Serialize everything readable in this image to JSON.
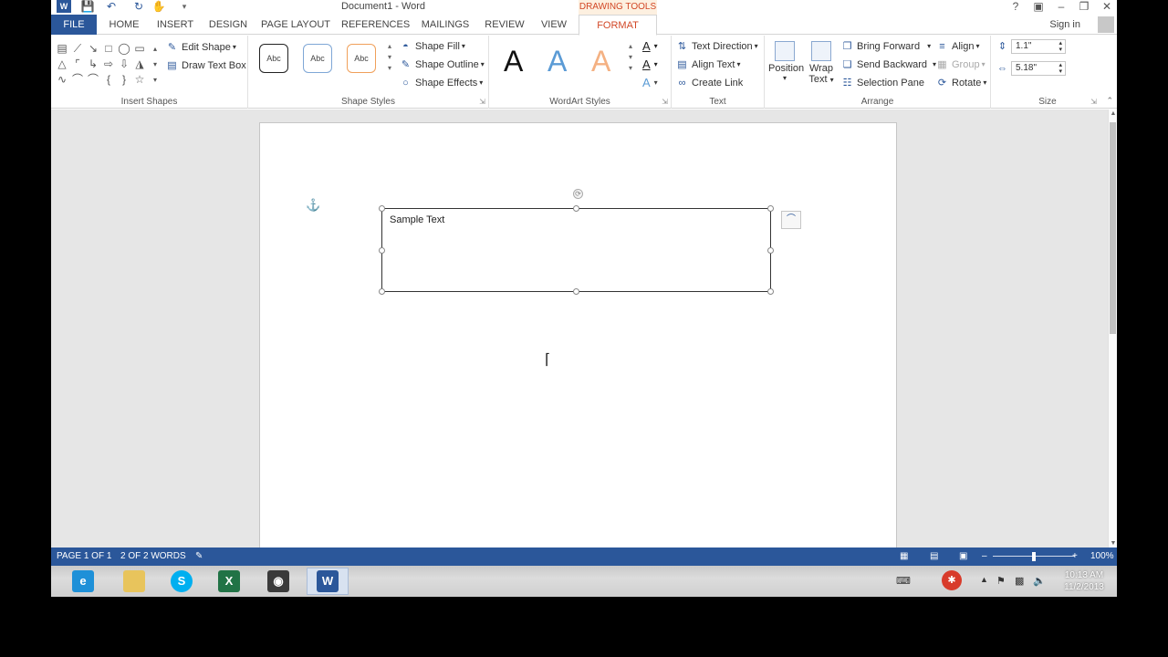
{
  "window": {
    "title": "Document1 - Word",
    "contextual_title": "DRAWING TOOLS",
    "sign_in": "Sign in"
  },
  "tabs": [
    "FILE",
    "HOME",
    "INSERT",
    "DESIGN",
    "PAGE LAYOUT",
    "REFERENCES",
    "MAILINGS",
    "REVIEW",
    "VIEW",
    "FORMAT"
  ],
  "ribbon": {
    "insert_shapes": {
      "label": "Insert Shapes",
      "edit_shape": "Edit Shape",
      "draw_text_box": "Draw Text Box"
    },
    "shape_styles": {
      "label": "Shape Styles",
      "style_sample": "Abc",
      "shape_fill": "Shape Fill",
      "shape_outline": "Shape Outline",
      "shape_effects": "Shape Effects"
    },
    "wordart_styles": {
      "label": "WordArt Styles",
      "letter": "A"
    },
    "text": {
      "label": "Text",
      "text_direction": "Text Direction",
      "align_text": "Align Text",
      "create_link": "Create Link"
    },
    "arrange": {
      "label": "Arrange",
      "position": "Position",
      "wrap_text_1": "Wrap",
      "wrap_text_2": "Text",
      "bring_forward": "Bring Forward",
      "send_backward": "Send Backward",
      "selection_pane": "Selection Pane",
      "align": "Align",
      "group": "Group",
      "rotate": "Rotate"
    },
    "size": {
      "label": "Size",
      "height": "1.1\"",
      "width": "5.18\""
    }
  },
  "document": {
    "textbox_text": "Sample Text"
  },
  "status": {
    "page": "PAGE 1 OF 1",
    "words": "2 OF 2 WORDS",
    "zoom": "100%",
    "zoom_level": 0.5
  },
  "taskbar": {
    "time": "10:13 AM",
    "date": "11/2/2013"
  },
  "colors": {
    "accent": "#2b579a",
    "contextual": "#d24726"
  }
}
